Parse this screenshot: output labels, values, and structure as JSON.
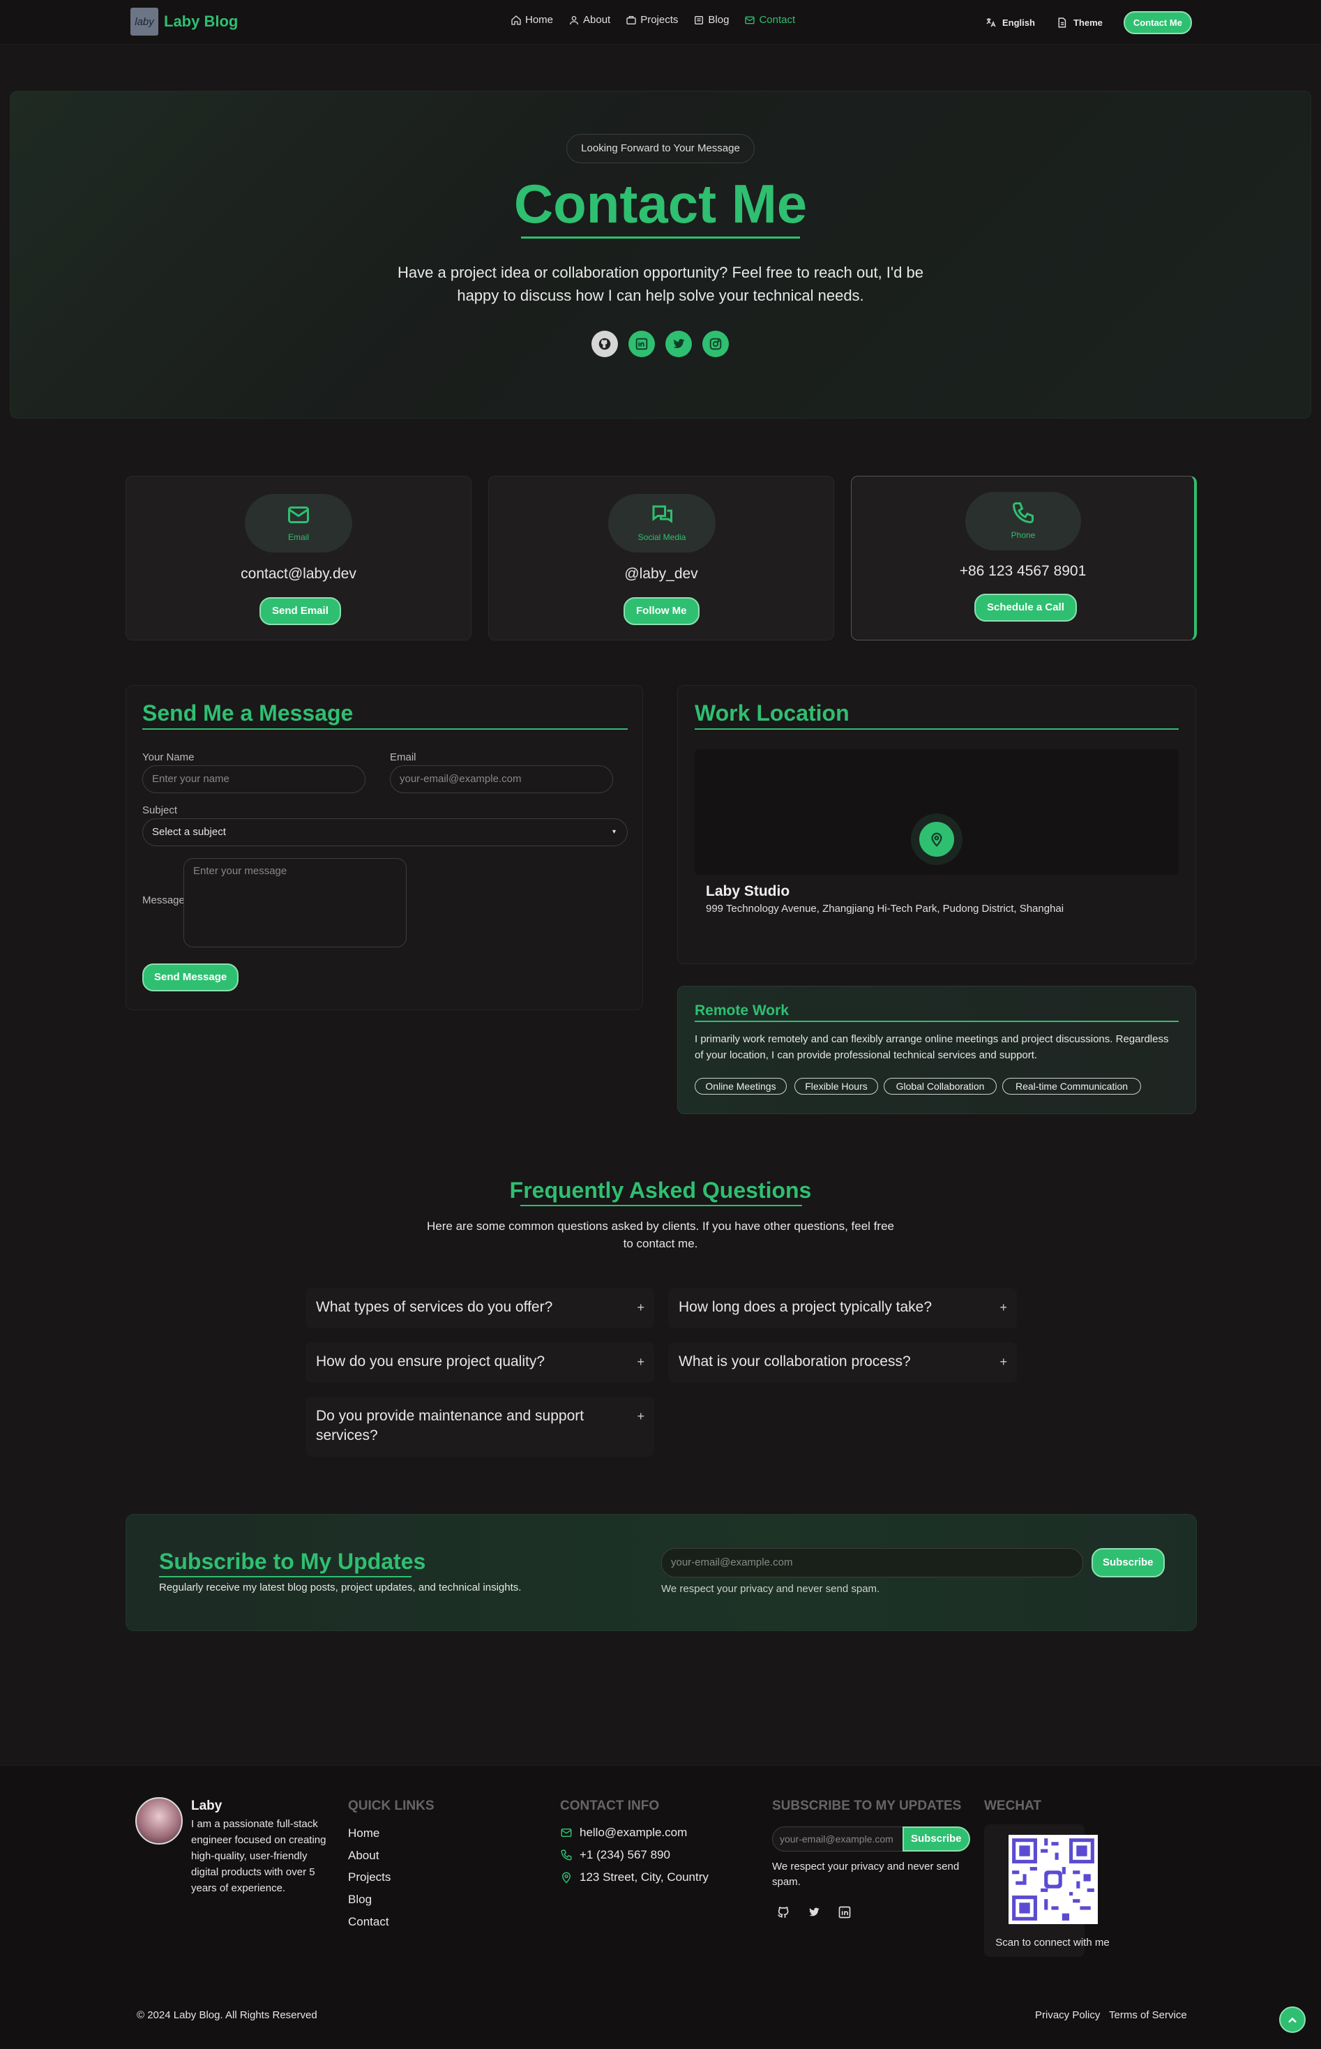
{
  "nav": {
    "logo_badge": "laby",
    "logo_text": "Laby Blog",
    "links": [
      {
        "label": "Home",
        "icon": "home-icon"
      },
      {
        "label": "About",
        "icon": "user-icon"
      },
      {
        "label": "Projects",
        "icon": "briefcase-icon"
      },
      {
        "label": "Blog",
        "icon": "book-icon"
      },
      {
        "label": "Contact",
        "icon": "mail-icon",
        "active": true
      }
    ],
    "language": "English",
    "theme": "Theme",
    "cta": "Contact Me"
  },
  "hero": {
    "badge": "Looking Forward to Your Message",
    "title": "Contact Me",
    "description": "Have a project idea or collaboration opportunity? Feel free to reach out, I'd be happy to discuss how I can help solve your technical needs.",
    "socials": [
      "github-icon",
      "linkedin-icon",
      "twitter-icon",
      "instagram-icon"
    ]
  },
  "cards": [
    {
      "label": "Email",
      "value": "contact@laby.dev",
      "button": "Send Email"
    },
    {
      "label": "Social Media",
      "value": "@laby_dev",
      "button": "Follow Me"
    },
    {
      "label": "Phone",
      "value": "+86 123 4567 8901",
      "button": "Schedule a Call"
    }
  ],
  "form": {
    "title": "Send Me a Message",
    "name_label": "Your Name",
    "name_placeholder": "Enter your name",
    "email_label": "Email",
    "email_placeholder": "your-email@example.com",
    "subject_label": "Subject",
    "subject_value": "Select a subject",
    "message_label": "Message",
    "message_placeholder": "Enter your message",
    "submit": "Send Message"
  },
  "location": {
    "title": "Work Location",
    "name": "Laby Studio",
    "address": "999 Technology Avenue, Zhangjiang Hi-Tech Park, Pudong District, Shanghai"
  },
  "remote": {
    "title": "Remote Work",
    "text": "I primarily work remotely and can flexibly arrange online meetings and project discussions. Regardless of your location, I can provide professional technical services and support.",
    "tags": [
      "Online Meetings",
      "Flexible Hours",
      "Global Collaboration",
      "Real-time Communication"
    ]
  },
  "faq": {
    "title": "Frequently Asked Questions",
    "description": "Here are some common questions asked by clients. If you have other questions, feel free to contact me.",
    "items": [
      "What types of services do you offer?",
      "How long does a project typically take?",
      "How do you ensure project quality?",
      "What is your collaboration process?",
      "Do you provide maintenance and support services?"
    ]
  },
  "subscribe": {
    "title": "Subscribe to My Updates",
    "text": "Regularly receive my latest blog posts, project updates, and technical insights.",
    "placeholder": "your-email@example.com",
    "button": "Subscribe",
    "note": "We respect your privacy and never send spam."
  },
  "footer": {
    "name": "Laby",
    "bio": "I am a passionate full-stack engineer focused on creating high-quality, user-friendly digital products with over 5 years of experience.",
    "quick_links_title": "QUICK LINKS",
    "quick_links": [
      "Home",
      "About",
      "Projects",
      "Blog",
      "Contact"
    ],
    "contact_title": "CONTACT INFO",
    "email": "hello@example.com",
    "phone": "+1 (234) 567 890",
    "address": "123 Street, City, Country",
    "subscribe_title": "SUBSCRIBE TO MY UPDATES",
    "subscribe_placeholder": "your-email@example.com",
    "subscribe_button": "Subscribe",
    "subscribe_note": "We respect your privacy and never send spam.",
    "wechat_title": "WECHAT",
    "wechat_caption": "Scan to connect with me",
    "copyright": "© 2024 Laby Blog. All Rights Reserved",
    "privacy": "Privacy Policy",
    "terms": "Terms of Service"
  },
  "colors": {
    "accent": "#2fbf71",
    "background": "#181616"
  }
}
